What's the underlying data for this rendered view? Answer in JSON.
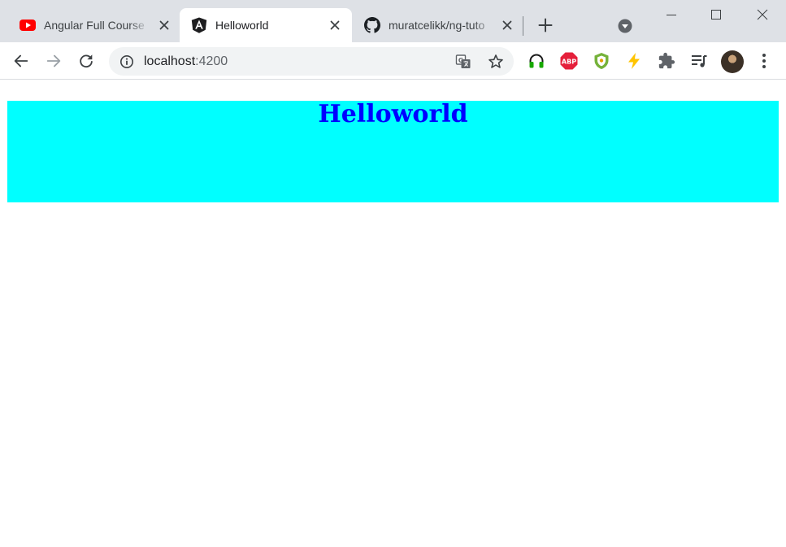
{
  "tabs": [
    {
      "title": "Angular Full Course",
      "favicon": "youtube-icon",
      "active": false
    },
    {
      "title": "Helloworld",
      "favicon": "angular-icon",
      "active": true
    },
    {
      "title": "muratcelikk/ng-tuto",
      "favicon": "github-icon",
      "active": false
    }
  ],
  "toolbar": {
    "url_host": "localhost",
    "url_port": ":4200"
  },
  "page": {
    "heading": "Helloworld"
  },
  "colors": {
    "banner_bg": "#00ffff",
    "heading_color": "#0000ff",
    "tabstrip_bg": "#dee1e6"
  }
}
